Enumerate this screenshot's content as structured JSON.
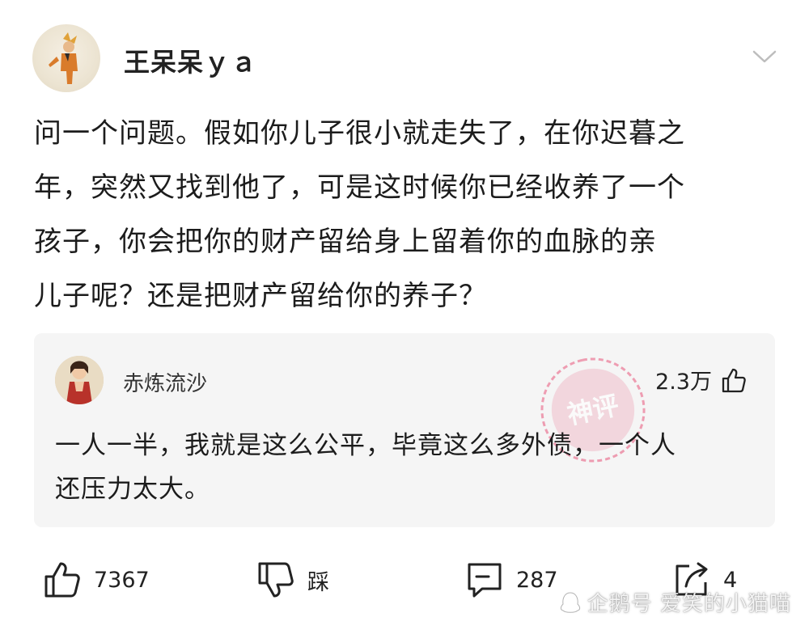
{
  "post": {
    "author": "王呆呆ｙａ",
    "lines": [
      "问一个问题。假如你儿子很小就走失了，在你迟暮之",
      "年，突然又找到他了，可是这时候你已经收养了一个",
      "孩子，你会把你的财产留给身上留着你的血脉的亲",
      "儿子呢？还是把财产留给你的养子？"
    ]
  },
  "hot_comment": {
    "author": "赤炼流沙",
    "likes": "2.3万",
    "stamp_text": "神评",
    "lines": [
      "一人一半，我就是这么公平，毕竟这么多外债，一个人",
      "还压力太大。"
    ]
  },
  "actions": {
    "like_count": "7367",
    "dislike_label": "踩",
    "comment_count": "287",
    "share_count": "4"
  },
  "watermark": {
    "text": "企鹅号 爱笑的小猫喵"
  },
  "colors": {
    "card_bg": "#f5f5f5",
    "stamp": "#e8557a",
    "text": "#1c1c1c"
  }
}
